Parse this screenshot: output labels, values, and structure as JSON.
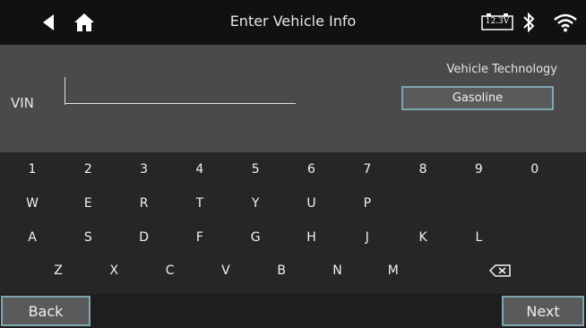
{
  "header": {
    "title": "Enter Vehicle Info",
    "battery_voltage": "12.3V",
    "icons": [
      "back-arrow-icon",
      "home-icon",
      "battery-icon",
      "bluetooth-icon",
      "wifi-icon"
    ]
  },
  "form": {
    "vin_label": "VIN",
    "vin_value": "",
    "technology_label": "Vehicle Technology",
    "technology_value": "Gasoline"
  },
  "keyboard": {
    "row1": [
      "1",
      "2",
      "3",
      "4",
      "5",
      "6",
      "7",
      "8",
      "9",
      "0"
    ],
    "row2": [
      "W",
      "E",
      "R",
      "T",
      "Y",
      "U",
      "P"
    ],
    "row3": [
      "A",
      "S",
      "D",
      "F",
      "G",
      "H",
      "J",
      "K",
      "L"
    ],
    "row4": [
      "Z",
      "X",
      "C",
      "V",
      "B",
      "N",
      "M"
    ]
  },
  "footer": {
    "back_label": "Back",
    "next_label": "Next"
  },
  "colors": {
    "accent_border": "#7fa6b3",
    "form_bg": "#4a4a4a",
    "keyboard_bg": "#262626"
  }
}
